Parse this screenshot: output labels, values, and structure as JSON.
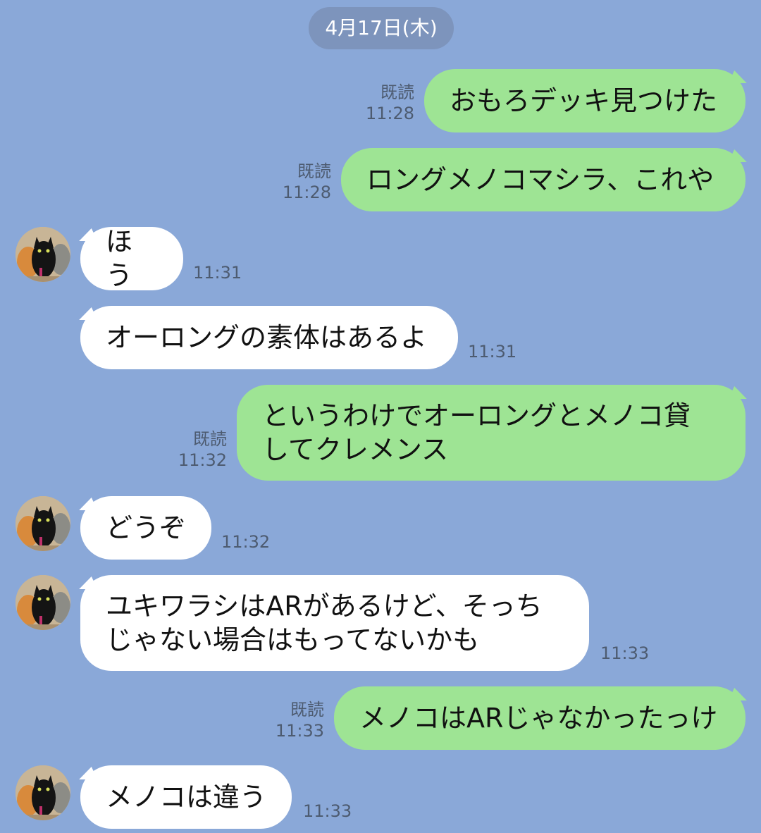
{
  "date_label": "4月17日(木)",
  "messages": [
    {
      "side": "out",
      "text": "おもろデッキ見つけた",
      "read": "既読",
      "time": "11:28"
    },
    {
      "side": "out",
      "text": "ロングメノコマシラ、これや",
      "read": "既読",
      "time": "11:28"
    },
    {
      "side": "in",
      "text": "ほう",
      "time": "11:31",
      "avatar": "cat-avatar"
    },
    {
      "side": "in",
      "text": "オーロングの素体はあるよ",
      "time": "11:31"
    },
    {
      "side": "out",
      "text": "というわけでオーロングとメノコ貸\nしてクレメンス",
      "read": "既読",
      "time": "11:32"
    },
    {
      "side": "in",
      "text": "どうぞ",
      "time": "11:32",
      "avatar": "cat-avatar"
    },
    {
      "side": "in",
      "text": "ユキワラシはARがあるけど、そっち\nじゃない場合はもってないかも",
      "time": "11:33",
      "avatar": "cat-avatar"
    },
    {
      "side": "out",
      "text": "メノコはARじゃなかったっけ",
      "read": "既読",
      "time": "11:33"
    },
    {
      "side": "in",
      "text": "メノコは違う",
      "time": "11:33",
      "avatar": "cat-avatar"
    }
  ],
  "colors": {
    "background": "#8aa8d8",
    "outgoing_bubble": "#9ee494",
    "incoming_bubble": "#ffffff",
    "date_pill": "#7d94bc"
  }
}
